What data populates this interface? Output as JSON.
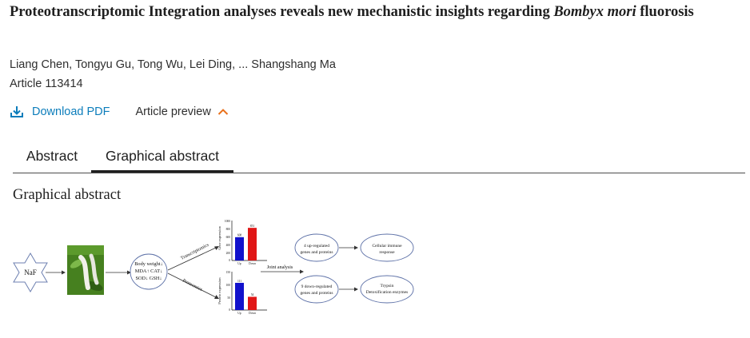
{
  "article": {
    "title_main": "Proteotranscriptomic Integration analyses reveals new mechanistic insights regarding ",
    "title_italic": "Bombyx mori",
    "title_end": " fluorosis",
    "authors": "Liang Chen, Tongyu Gu, Tong Wu, Lei Ding, ... Shangshang Ma",
    "article_number": "Article 113414"
  },
  "actions": {
    "download_label": "Download PDF",
    "preview_label": "Article preview"
  },
  "tabs": [
    {
      "label": "Abstract"
    },
    {
      "label": "Graphical abstract"
    }
  ],
  "section": {
    "heading": "Graphical abstract"
  },
  "graphic": {
    "naf": "NaF",
    "effects": [
      "Body weight↓",
      "MDA↑ CAT↓",
      "SOD↓ GSH↓"
    ],
    "transcriptomics": "Transcriptomics",
    "proteomics": "Proteomics",
    "joint": "Joint analysis",
    "top_chart": {
      "ylabel": "Gene expression",
      "yticks": [
        "1000",
        "800",
        "600",
        "400",
        "200",
        "0"
      ],
      "categories": [
        "Up",
        "Down"
      ],
      "value_labels": [
        "608",
        "851"
      ]
    },
    "bottom_chart": {
      "ylabel": "Protein expression",
      "yticks": [
        "150",
        "100",
        "50",
        "0"
      ],
      "categories": [
        "Up",
        "Down"
      ],
      "value_labels": [
        "111",
        "54"
      ]
    },
    "up_box": [
      "4 up-regulated",
      "genes and proteins"
    ],
    "down_box": [
      "9 down-regulated",
      "genes and proteins"
    ],
    "immune": [
      "Cellular immune",
      "response"
    ],
    "trypsin": [
      "Trypsin",
      "Detoxification enzymes"
    ],
    "colors": {
      "up_bar": "#1111cc",
      "down_bar": "#e01616"
    }
  },
  "chart_data": [
    {
      "type": "bar",
      "categories": [
        "Up",
        "Down"
      ],
      "values": [
        608,
        851
      ],
      "ylabel": "Gene expression",
      "ylim": [
        0,
        1000
      ]
    },
    {
      "type": "bar",
      "categories": [
        "Up",
        "Down"
      ],
      "values": [
        111,
        54
      ],
      "ylabel": "Protein expression",
      "ylim": [
        0,
        150
      ]
    }
  ]
}
